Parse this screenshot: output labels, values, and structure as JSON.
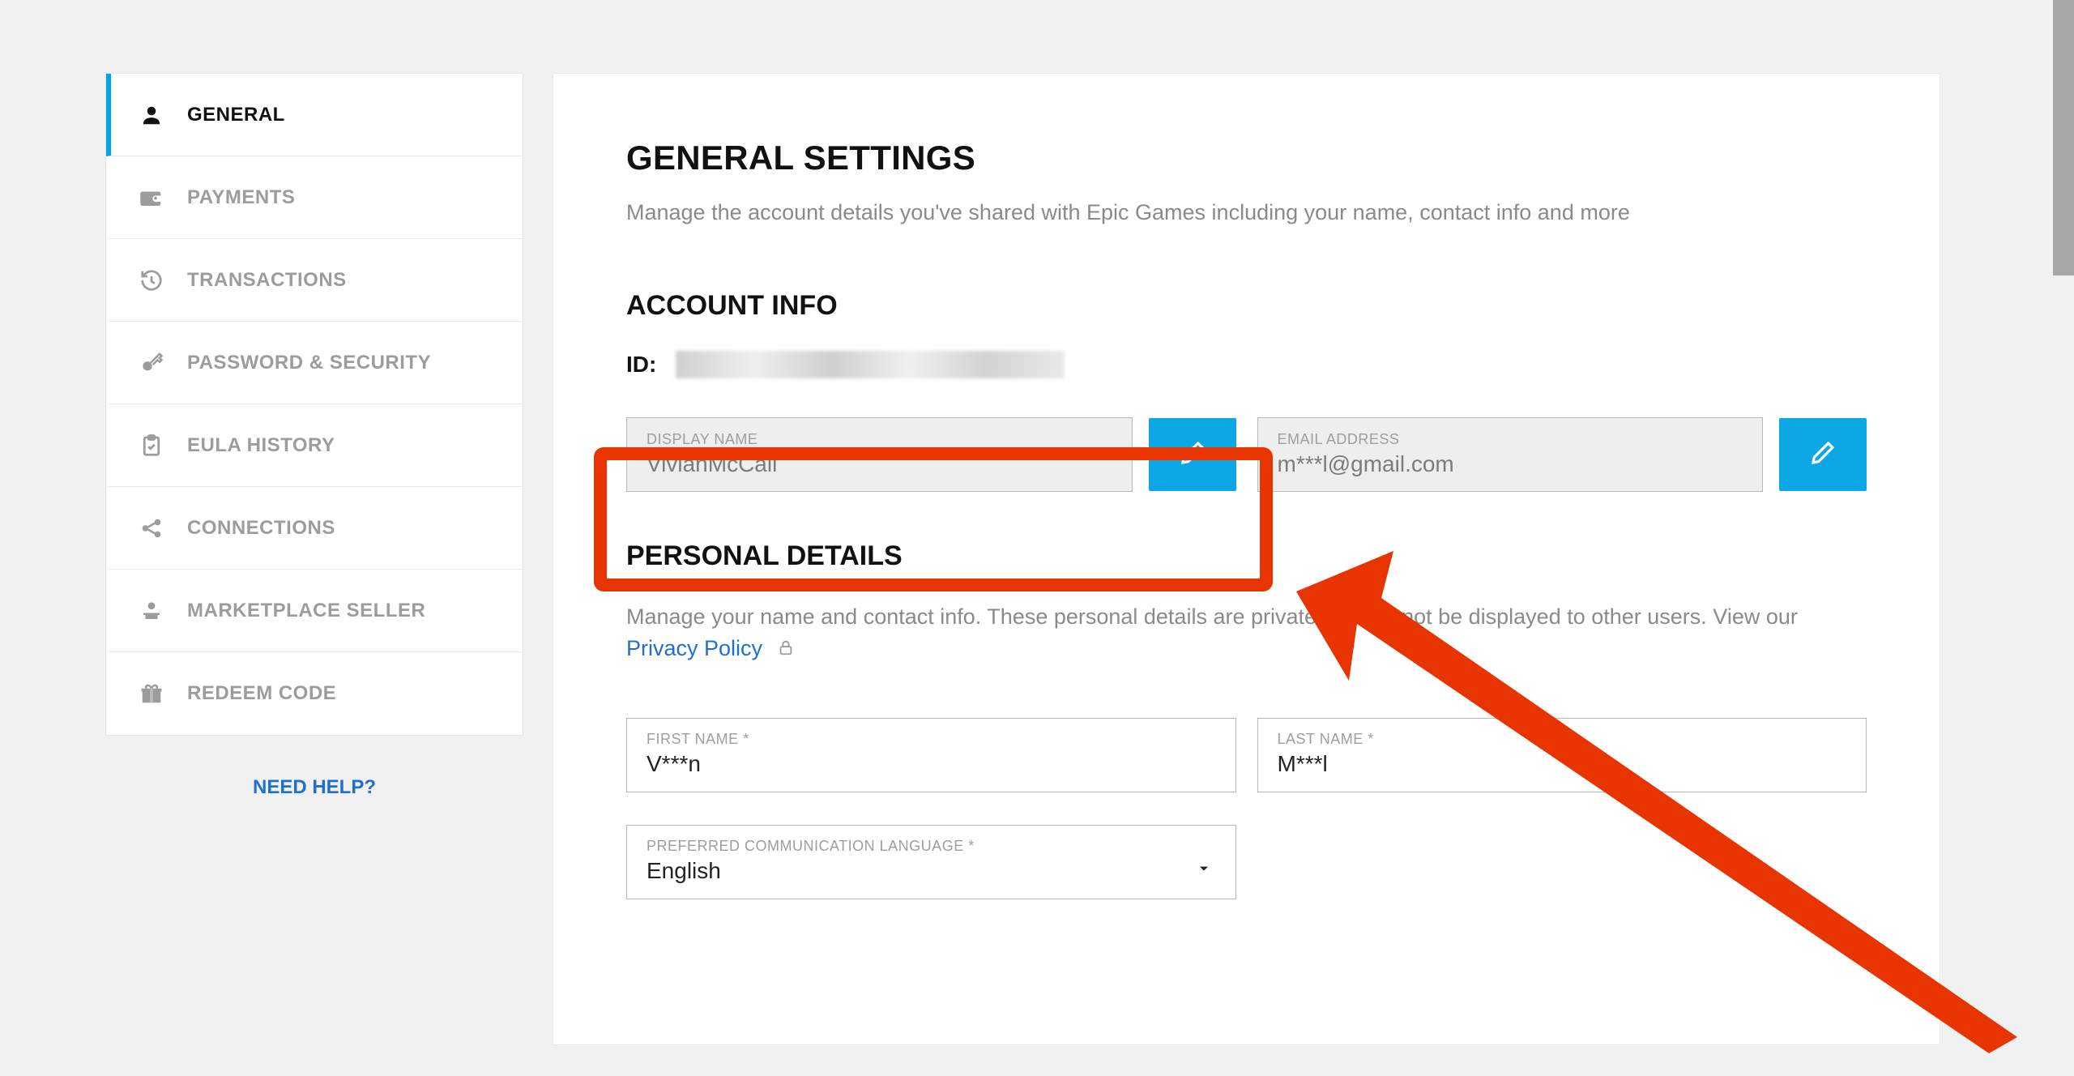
{
  "sidebar": {
    "items": [
      {
        "label": "GENERAL",
        "icon": "user-icon"
      },
      {
        "label": "PAYMENTS",
        "icon": "wallet-icon"
      },
      {
        "label": "TRANSACTIONS",
        "icon": "history-icon"
      },
      {
        "label": "PASSWORD & SECURITY",
        "icon": "key-icon"
      },
      {
        "label": "EULA HISTORY",
        "icon": "clipboard-icon"
      },
      {
        "label": "CONNECTIONS",
        "icon": "share-icon"
      },
      {
        "label": "MARKETPLACE SELLER",
        "icon": "seller-icon"
      },
      {
        "label": "REDEEM CODE",
        "icon": "gift-icon"
      }
    ],
    "need_help": "NEED HELP?"
  },
  "header": {
    "title": "GENERAL SETTINGS",
    "subtitle": "Manage the account details you've shared with Epic Games including your name, contact info and more"
  },
  "account_info": {
    "title": "ACCOUNT INFO",
    "id_label": "ID:",
    "display_name": {
      "label": "DISPLAY NAME",
      "value": "VivianMcCall"
    },
    "email": {
      "label": "EMAIL ADDRESS",
      "value": "m***l@gmail.com"
    }
  },
  "personal": {
    "title": "PERSONAL DETAILS",
    "desc": "Manage your name and contact info. These personal details are private and will not be displayed to other users. View our",
    "privacy_link": "Privacy Policy",
    "first_name": {
      "label": "FIRST NAME *",
      "value": "V***n"
    },
    "last_name": {
      "label": "LAST NAME *",
      "value": "M***l"
    },
    "language": {
      "label": "PREFERRED COMMUNICATION LANGUAGE *",
      "value": "English"
    }
  },
  "colors": {
    "accent": "#0ea7e6",
    "highlight": "#e83400",
    "link": "#1f6fd0"
  }
}
